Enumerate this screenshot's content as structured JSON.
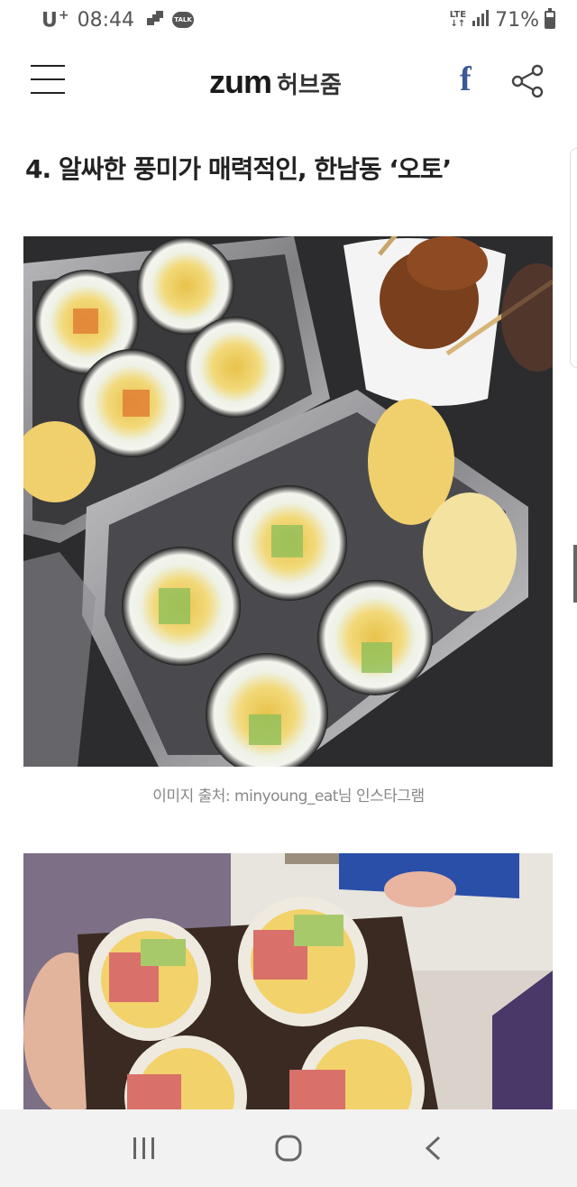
{
  "status_bar": {
    "carrier": "U",
    "carrier_plus": "+",
    "time": "08:44",
    "talk_badge": "TALK",
    "network": "LTE",
    "battery_percent": "71%",
    "battery_level": 0.71,
    "icons": [
      "gallery-notification-icon",
      "kakaotalk-icon",
      "lte-icon",
      "signal-icon",
      "battery-icon"
    ]
  },
  "header": {
    "logo_main": "ZUM",
    "logo_sub": "허브줌",
    "menu_icon": "hamburger-menu-icon",
    "facebook_label": "f",
    "share_icon": "share-icon"
  },
  "article": {
    "headline": "4. 알싸한 풍미가 매력적인, 한남동 ‘오토’",
    "image1_caption": "이미지 출처: minyoung_eat님 인스타그램"
  },
  "nav_bar": {
    "icons": [
      "recent-apps-icon",
      "home-icon",
      "back-icon"
    ]
  },
  "colors": {
    "facebook": "#3b5998",
    "caption": "#888888",
    "nav_bg": "#f2f2f2"
  }
}
